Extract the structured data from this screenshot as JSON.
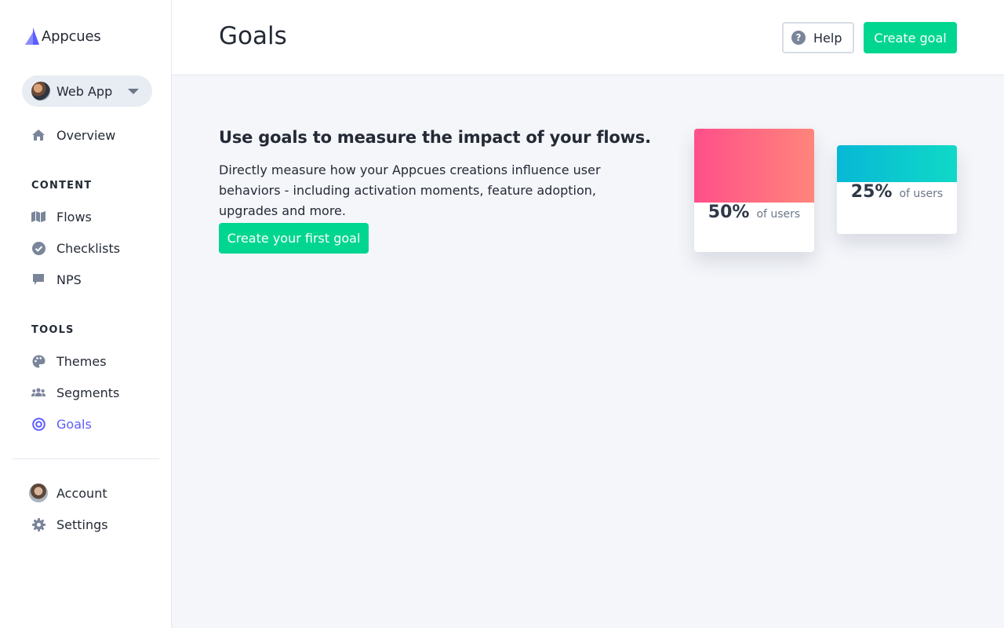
{
  "brand": {
    "name": "Appcues",
    "accent": "#5c5cff",
    "primary_button": "#00d68f"
  },
  "app_selector": {
    "label": "Web App"
  },
  "sidebar": {
    "overview": "Overview",
    "content_heading": "CONTENT",
    "content_items": [
      "Flows",
      "Checklists",
      "NPS"
    ],
    "tools_heading": "TOOLS",
    "tools_items": [
      "Themes",
      "Segments",
      "Goals"
    ],
    "active_item": "Goals",
    "account": "Account",
    "settings": "Settings"
  },
  "header": {
    "title": "Goals",
    "help_label": "Help",
    "create_label": "Create goal"
  },
  "main": {
    "headline": "Use goals to measure the impact of your flows.",
    "description": "Directly measure how your Appcues creations influence user behaviors - including activation moments, feature adoption, upgrades and more.",
    "cta_label": "Create your first goal",
    "cards": [
      {
        "percent": "50%",
        "subtext": "of users",
        "color_start": "#ff4f8a",
        "color_end": "#ff857a"
      },
      {
        "percent": "25%",
        "subtext": "of users",
        "color_start": "#07b8d6",
        "color_end": "#10d9c7"
      }
    ]
  }
}
